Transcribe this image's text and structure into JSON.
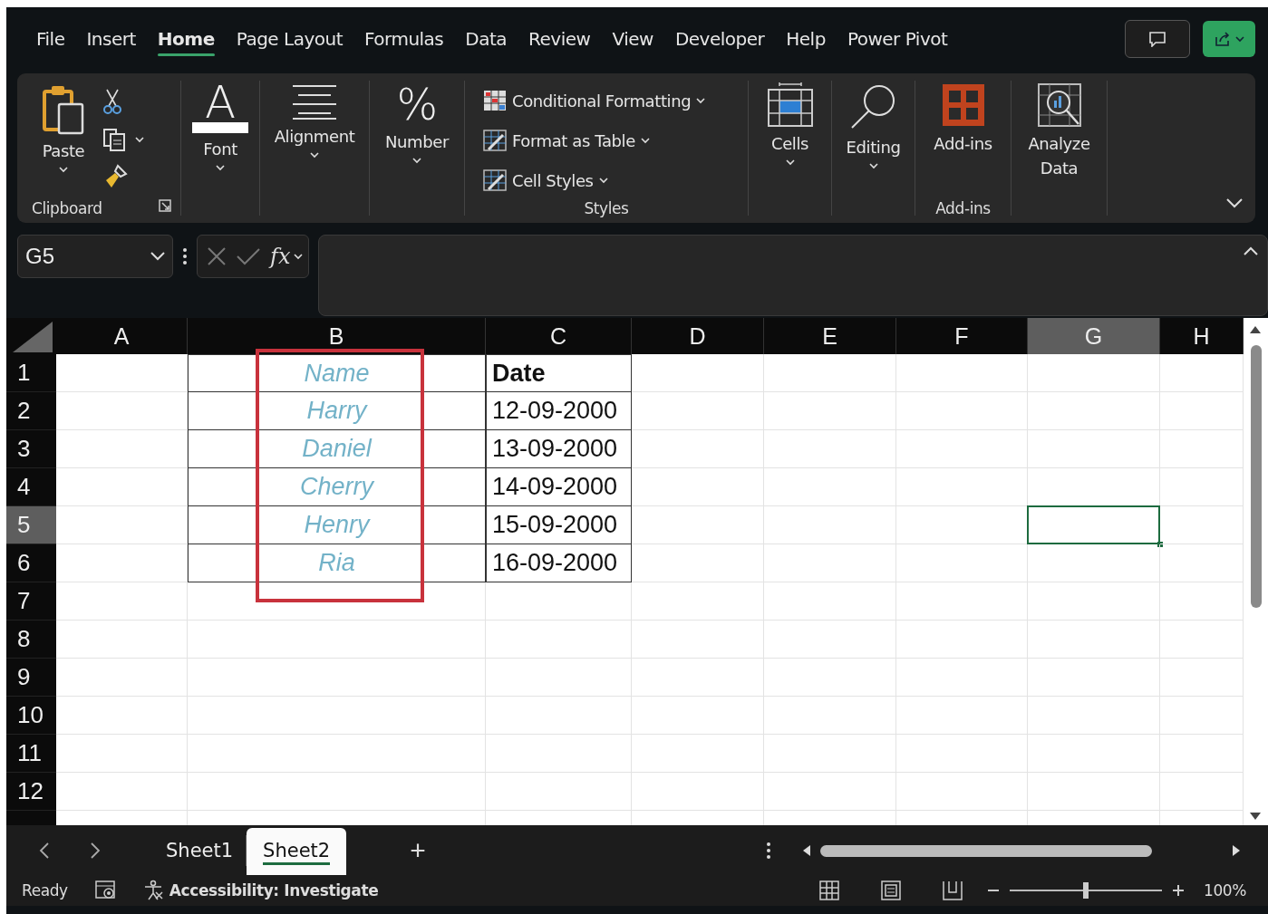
{
  "menu_tabs": [
    {
      "label": "File",
      "selected": false
    },
    {
      "label": "Insert",
      "selected": false
    },
    {
      "label": "Home",
      "selected": true
    },
    {
      "label": "Page Layout",
      "selected": false
    },
    {
      "label": "Formulas",
      "selected": false
    },
    {
      "label": "Data",
      "selected": false
    },
    {
      "label": "Review",
      "selected": false
    },
    {
      "label": "View",
      "selected": false
    },
    {
      "label": "Developer",
      "selected": false
    },
    {
      "label": "Help",
      "selected": false
    },
    {
      "label": "Power Pivot",
      "selected": false
    }
  ],
  "ribbon": {
    "groups": [
      {
        "kind": "clipboard",
        "button": "Paste",
        "title": "Clipboard"
      },
      {
        "kind": "font",
        "button": "Font",
        "glyph": "A"
      },
      {
        "kind": "alignment",
        "button": "Alignment"
      },
      {
        "kind": "number",
        "button": "Number",
        "glyph": "%"
      },
      {
        "kind": "styles",
        "title": "Styles",
        "items": [
          "Conditional Formatting",
          "Format as Table",
          "Cell Styles"
        ]
      },
      {
        "kind": "cells",
        "button": "Cells"
      },
      {
        "kind": "editing",
        "button": "Editing"
      },
      {
        "kind": "addins",
        "button": "Add-ins",
        "title": "Add-ins"
      },
      {
        "kind": "analyze",
        "button": "Analyze Data"
      }
    ]
  },
  "formula_bar": {
    "name_box": "G5",
    "function_label": "fx"
  },
  "sheet": {
    "columns": [
      {
        "label": "A",
        "selected": false
      },
      {
        "label": "B",
        "selected": false
      },
      {
        "label": "C",
        "selected": false
      },
      {
        "label": "D",
        "selected": false
      },
      {
        "label": "E",
        "selected": false
      },
      {
        "label": "F",
        "selected": false
      },
      {
        "label": "G",
        "selected": true
      },
      {
        "label": "H",
        "selected": false
      }
    ],
    "rows": [
      {
        "number": "1",
        "selected": false,
        "kind": "header",
        "column_b": "Name",
        "column_c": "Date"
      },
      {
        "number": "2",
        "selected": false,
        "kind": "data",
        "column_b": "Harry",
        "column_c": "12-09-2000"
      },
      {
        "number": "3",
        "selected": false,
        "kind": "data",
        "column_b": "Daniel",
        "column_c": "13-09-2000"
      },
      {
        "number": "4",
        "selected": false,
        "kind": "data",
        "column_b": "Cherry",
        "column_c": "14-09-2000"
      },
      {
        "number": "5",
        "selected": true,
        "kind": "data",
        "column_b": "Henry",
        "column_c": "15-09-2000"
      },
      {
        "number": "6",
        "selected": false,
        "kind": "data",
        "column_b": "Ria",
        "column_c": "16-09-2000"
      },
      {
        "number": "7",
        "selected": false,
        "kind": "blank"
      },
      {
        "number": "8",
        "selected": false,
        "kind": "blank"
      },
      {
        "number": "9",
        "selected": false,
        "kind": "blank"
      },
      {
        "number": "10",
        "selected": false,
        "kind": "blank"
      },
      {
        "number": "11",
        "selected": false,
        "kind": "blank"
      },
      {
        "number": "12",
        "selected": false,
        "kind": "blank"
      }
    ]
  },
  "sheet_tabs": [
    {
      "label": "Sheet1",
      "selected": false
    },
    {
      "label": "Sheet2",
      "selected": true
    }
  ],
  "add_sheet": "+",
  "status_bar": {
    "status": "Ready",
    "accessibility": "Accessibility: Investigate",
    "zoom": {
      "level": 0.5,
      "reading": "100%"
    }
  }
}
